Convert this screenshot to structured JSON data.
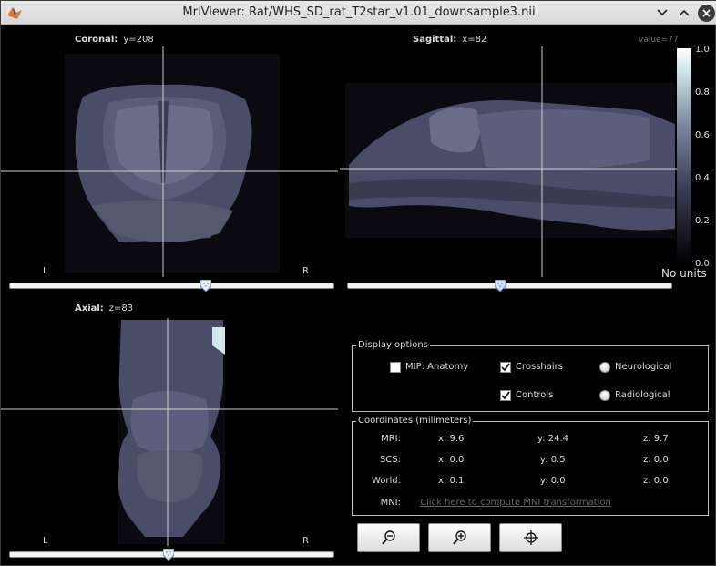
{
  "window": {
    "title": "MriViewer: Rat/WHS_SD_rat_T2star_v1.01_downsample3.nii"
  },
  "views": {
    "coronal": {
      "label": "Coronal:",
      "coord": "y=208",
      "left": "L",
      "right": "R",
      "slider_position": 0.61
    },
    "sagittal": {
      "label": "Sagittal:",
      "coord": "x=82",
      "slider_position": 0.47
    },
    "axial": {
      "label": "Axial:",
      "coord": "z=83",
      "left": "L",
      "right": "R",
      "slider_position": 0.49
    }
  },
  "value_readout": "value=77",
  "colorbar": {
    "ticks": [
      "1.0",
      "0.8",
      "0.6",
      "0.4",
      "0.2",
      "0.0"
    ],
    "units": "No units"
  },
  "display_options": {
    "title": "Display options",
    "mip_label": "MIP: Anatomy",
    "mip_checked": false,
    "crosshairs_label": "Crosshairs",
    "crosshairs_checked": true,
    "controls_label": "Controls",
    "controls_checked": true,
    "neurological_label": "Neurological",
    "radiological_label": "Radiological"
  },
  "coordinates": {
    "title": "Coordinates (milimeters)",
    "rows": [
      {
        "label": "MRI:",
        "x": "x: 9.6",
        "y": "y: 24.4",
        "z": "z: 9.7"
      },
      {
        "label": "SCS:",
        "x": "x: 0.0",
        "y": "y: 0.5",
        "z": "z: 0.0"
      },
      {
        "label": "World:",
        "x": "x: 0.1",
        "y": "y: 0.0",
        "z": "z: 0.0"
      }
    ],
    "mni_label": "MNI:",
    "mni_link": "Click here to compute MNI transformation"
  },
  "toolbar": {
    "zoom_out_icon": "zoom-out-icon",
    "zoom_in_icon": "zoom-in-icon",
    "center_icon": "crosshair-target-icon"
  }
}
